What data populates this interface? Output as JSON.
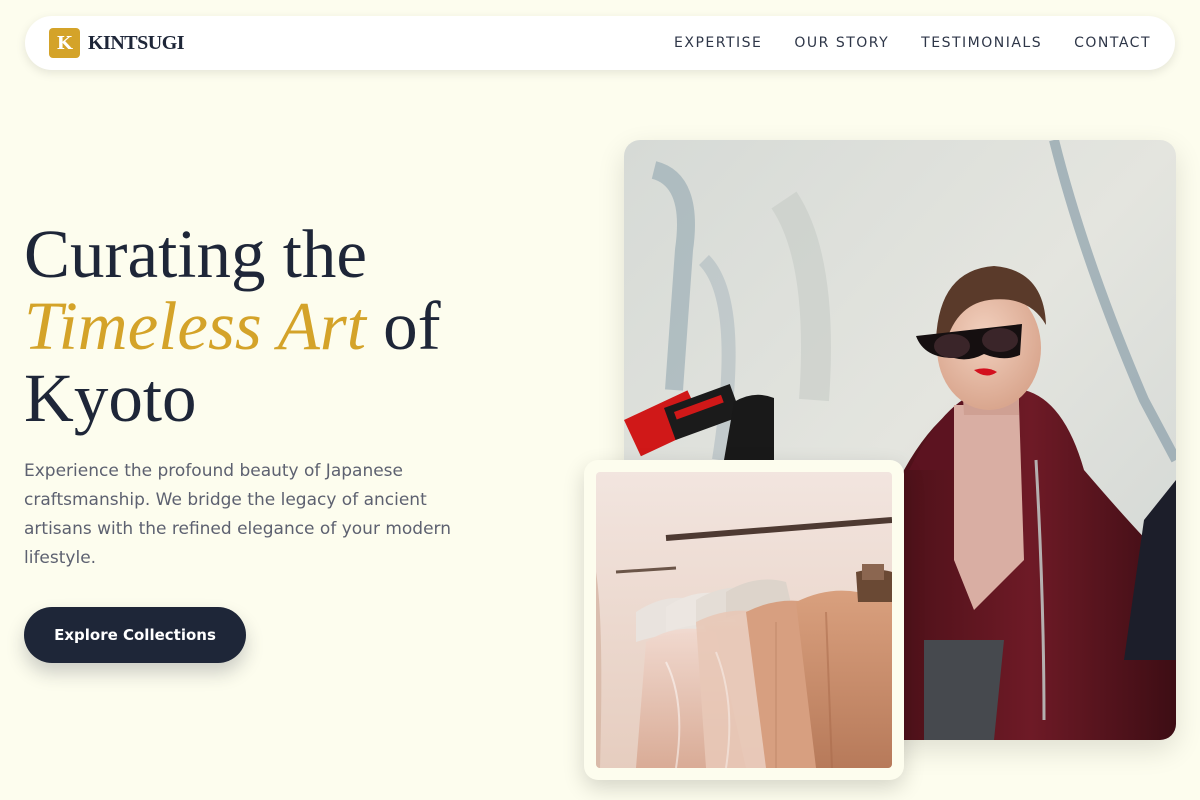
{
  "brand": {
    "mark": "K",
    "name": "KINTSUGI"
  },
  "nav": {
    "links": [
      "EXPERTISE",
      "OUR STORY",
      "TESTIMONIALS",
      "CONTACT"
    ]
  },
  "hero": {
    "title_line1": "Curating the",
    "title_accent": "Timeless Art",
    "title_of": "of",
    "title_line3": "Kyoto",
    "description": "Experience the profound beauty of Japanese craftsmanship. We bridge the legacy of ancient artisans with the refined elegance of your modern lifestyle.",
    "cta_label": "Explore Collections"
  },
  "colors": {
    "accent": "#d4a329",
    "navy": "#1e2638",
    "background": "#fdfdee"
  }
}
